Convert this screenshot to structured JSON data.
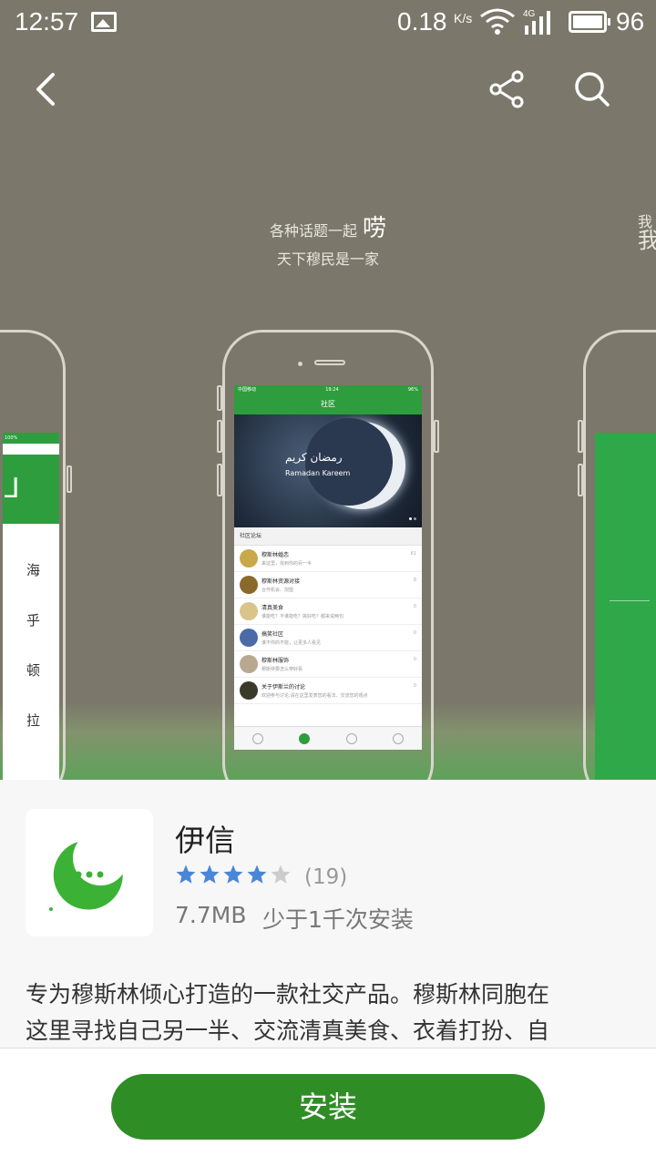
{
  "status_bar": {
    "time": "12:57",
    "net_speed": "0.18",
    "net_unit": "K/s",
    "cell_type": "4G",
    "battery": "96"
  },
  "carousel": {
    "center_caption_line1": "各种话题一起",
    "center_caption_emphasis": "唠",
    "center_caption_line2": "天下穆民是一家",
    "right_caption_line1": "我",
    "right_caption_line2": "我",
    "left_screen_chars": [
      "海",
      "乎",
      "顿",
      "拉"
    ],
    "left_status": "100%",
    "center_screen": {
      "carrier": "中国移动",
      "time": "19:24",
      "battery": "96%",
      "title": "社区",
      "banner_arabic": "رمضان كريم",
      "banner_text": "Ramadan Kareem",
      "section": "社区论坛",
      "forum_rows": [
        {
          "title": "穆斯林婚恋",
          "sub": "来这里，找到你的另一半",
          "count": "61",
          "avatar_color": "#c9a84a"
        },
        {
          "title": "穆斯林资源对接",
          "sub": "合作机会、加盟",
          "count": "8",
          "avatar_color": "#8a6a2a"
        },
        {
          "title": "清真美食",
          "sub": "谁能吃？不谁能吃？挑好吃？都来说两句",
          "count": "0",
          "avatar_color": "#d9c48a"
        },
        {
          "title": "搞笑社区",
          "sub": "谁不你的不能，让更多人看见",
          "count": "0",
          "avatar_color": "#4a6aa8"
        },
        {
          "title": "穆斯林服饰",
          "sub": "穆斯林要怎么穿好看",
          "count": "0",
          "avatar_color": "#b8a890"
        },
        {
          "title": "关于伊斯兰的讨论",
          "sub": "欢迎参与讨论,请在这里发表您的看法、交流您的观点",
          "count": "0",
          "avatar_color": "#3a3a2a"
        }
      ]
    }
  },
  "app": {
    "name": "伊信",
    "rating": 4,
    "rating_max": 5,
    "rating_count": "(19)",
    "size": "7.7MB",
    "installs": "少于1千次安装",
    "description_line1": "专为穆斯林倾心打造的一款社交产品。穆斯林同胞在",
    "description_line2": "这里寻找自己另一半、交流清真美食、衣着打扮、自",
    "icon_color": "#3bb236"
  },
  "actions": {
    "install_label": "安装"
  },
  "colors": {
    "hero_bg": "#7b776a",
    "brand_green": "#2f8d26",
    "star_blue": "#4a86d8",
    "star_gray": "#cccccc"
  },
  "icons": {
    "back": "back-arrow-icon",
    "share": "share-icon",
    "search": "search-icon"
  }
}
